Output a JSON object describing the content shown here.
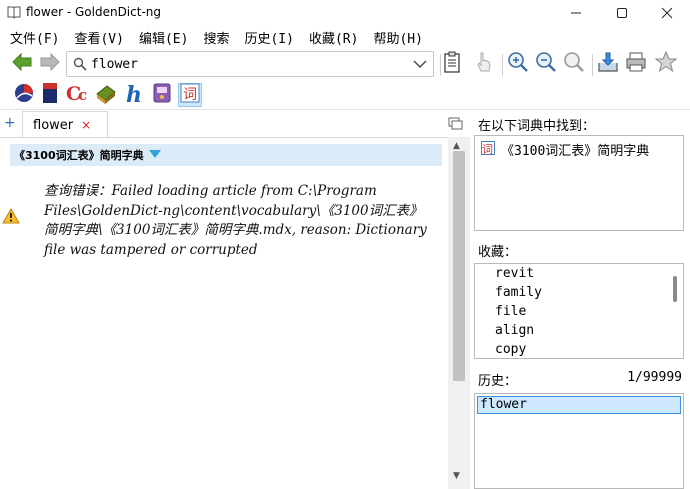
{
  "window": {
    "title": "flower - GoldenDict-ng"
  },
  "menu": {
    "items": [
      "文件(F)",
      "查看(V)",
      "编辑(E)",
      "搜索",
      "历史(I)",
      "收藏(R)",
      "帮助(H)"
    ]
  },
  "search": {
    "value": "flower"
  },
  "tabs": [
    {
      "label": "flower"
    }
  ],
  "article": {
    "dict_title": "《3100词汇表》简明字典",
    "error_message": "查询错误：Failed loading article from C:\\Program Files\\GoldenDict-ng\\content\\vocabulary\\《3100词汇表》简明字典\\《3100词汇表》简明字典.mdx, reason: Dictionary file was tampered or corrupted"
  },
  "found_in": {
    "label": "在以下词典中找到：",
    "items": [
      "《3100词汇表》简明字典"
    ]
  },
  "favorites": {
    "label": "收藏：",
    "items": [
      "revit",
      "family",
      "file",
      "align",
      "copy"
    ]
  },
  "history": {
    "label": "历史：",
    "count": "1/99999",
    "items": [
      "flower"
    ]
  },
  "colors": {
    "header_bg": "#dcebf8",
    "selected_bg": "#cde8ff",
    "accent": "#3a8ee6"
  }
}
